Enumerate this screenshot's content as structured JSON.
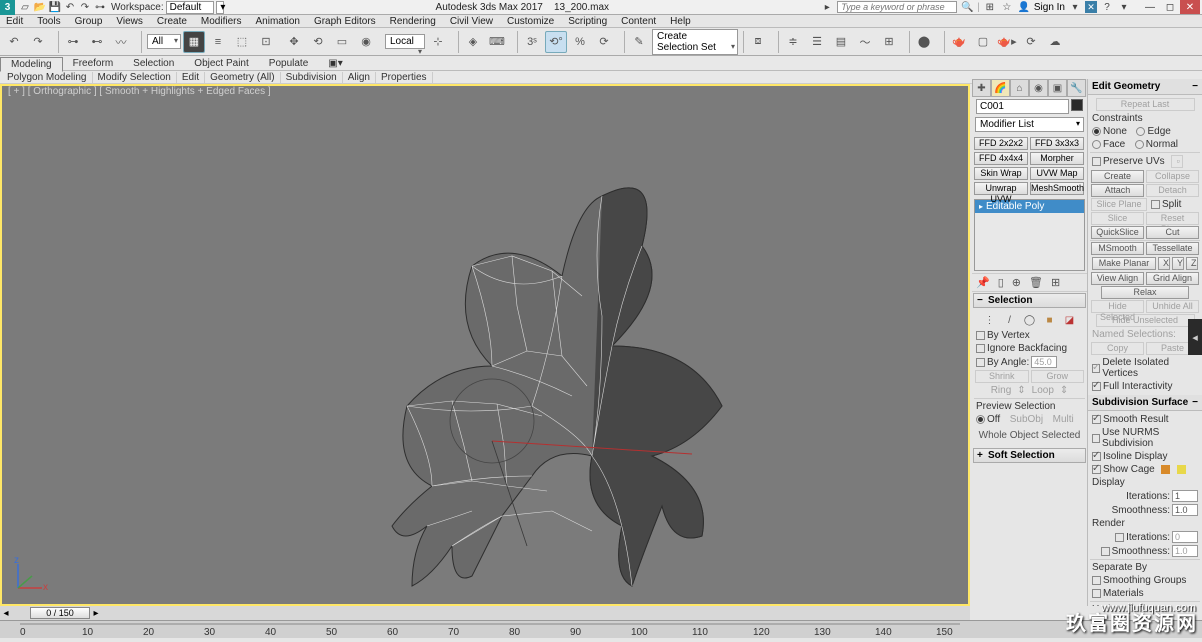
{
  "title": {
    "app": "Autodesk 3ds Max 2017",
    "file": "13_200.max"
  },
  "qat": [
    "new",
    "open",
    "save",
    "undo",
    "redo",
    "link"
  ],
  "workspace": {
    "label": "Workspace:",
    "value": "Default"
  },
  "search_placeholder": "Type a keyword or phrase",
  "signin": "Sign In",
  "menus": [
    "Edit",
    "Tools",
    "Group",
    "Views",
    "Create",
    "Modifiers",
    "Animation",
    "Graph Editors",
    "Rendering",
    "Civil View",
    "Customize",
    "Scripting",
    "Content",
    "Help"
  ],
  "ref_dd": "All",
  "coord_dd": "Local",
  "sel_set_dd": "Create Selection Set",
  "ribbon_tabs": [
    "Modeling",
    "Freeform",
    "Selection",
    "Object Paint",
    "Populate"
  ],
  "ribbon_sub": [
    "Polygon Modeling",
    "Modify Selection",
    "Edit",
    "Geometry (All)",
    "Subdivision",
    "Align",
    "Properties"
  ],
  "vp_label": "[ + ] [ Orthographic ] [ Smooth + Highlights + Edged Faces ]",
  "cmd": {
    "object_name": "C001",
    "modifier_list": "Modifier List",
    "mod_buttons": [
      "FFD 2x2x2",
      "FFD 3x3x3",
      "FFD 4x4x4",
      "Morpher",
      "Skin Wrap",
      "UVW Map",
      "Unwrap UVW",
      "MeshSmooth"
    ],
    "stack_item": "Editable Poly",
    "selection": {
      "title": "Selection",
      "by_vertex": "By Vertex",
      "ignore_backfacing": "Ignore Backfacing",
      "by_angle": "By Angle:",
      "by_angle_val": "45.0",
      "shrink": "Shrink",
      "grow": "Grow",
      "ring": "Ring",
      "loop": "Loop",
      "preview_selection": "Preview Selection",
      "off": "Off",
      "subobj": "SubObj",
      "multi": "Multi",
      "status": "Whole Object Selected"
    },
    "soft_selection": "Soft Selection"
  },
  "edit_geom": {
    "title": "Edit Geometry",
    "repeat_last": "Repeat Last",
    "constraints": "Constraints",
    "none": "None",
    "edge": "Edge",
    "face": "Face",
    "normal": "Normal",
    "preserve_uvs": "Preserve UVs",
    "create": "Create",
    "collapse": "Collapse",
    "attach": "Attach",
    "detach": "Detach",
    "slice_plane": "Slice Plane",
    "split": "Split",
    "slice": "Slice",
    "reset_plane": "Reset Plane",
    "quickslice": "QuickSlice",
    "cut": "Cut",
    "msmooth": "MSmooth",
    "tessellate": "Tessellate",
    "make_planar": "Make Planar",
    "x": "X",
    "y": "Y",
    "z": "Z",
    "view_align": "View Align",
    "grid_align": "Grid Align",
    "relax": "Relax",
    "hide_selected": "Hide Selected",
    "unhide_all": "Unhide All",
    "hide_unselected": "Hide Unselected",
    "named_selections": "Named Selections:",
    "copy": "Copy",
    "paste": "Paste",
    "delete_isolated": "Delete Isolated Vertices",
    "full_interactivity": "Full Interactivity"
  },
  "subdiv": {
    "title": "Subdivision Surface",
    "smooth_result": "Smooth Result",
    "use_nurms": "Use NURMS Subdivision",
    "isoline": "Isoline Display",
    "show_cage": "Show Cage",
    "display": "Display",
    "iterations": "Iterations:",
    "iter_val": "1",
    "smoothness": "Smoothness:",
    "smooth_val": "1.0",
    "render": "Render",
    "r_iter_val": "0",
    "r_smooth_val": "1.0",
    "separate_by": "Separate By",
    "smoothing_groups": "Smoothing Groups",
    "materials": "Materials",
    "update_options": "Update Options"
  },
  "time": {
    "slider": "0 / 150"
  },
  "watermark": "玖富圈资源网",
  "watermark_url": "www.jiufuquan.com"
}
